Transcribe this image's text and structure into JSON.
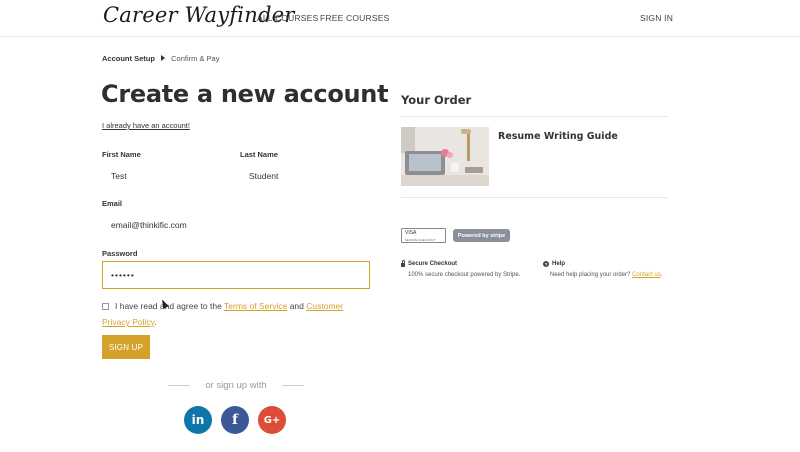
{
  "header": {
    "logo": "Career Wayfinder",
    "nav": [
      "ALL COURSES",
      "FREE COURSES"
    ],
    "signin": "SIGN IN"
  },
  "breadcrumb": {
    "active": "Account Setup",
    "inactive": "Confirm & Pay"
  },
  "page_title": "Create a new account",
  "already_link": "I already have an account!",
  "form": {
    "first_name": {
      "label": "First Name",
      "value": "Test"
    },
    "last_name": {
      "label": "Last Name",
      "value": "Student"
    },
    "email": {
      "label": "Email",
      "value": "email@thinkific.com"
    },
    "password": {
      "label": "Password",
      "value": "••••••"
    },
    "terms": {
      "prefix": "I have read and agree to the",
      "tos": "Terms of Service",
      "and": "and",
      "privacy": "Customer Privacy Policy",
      "suffix": "."
    },
    "signup_button": "SIGN UP",
    "or_text": "or sign up with",
    "social": {
      "linkedin": "in",
      "facebook": "f",
      "google": "G+"
    }
  },
  "order": {
    "title": "Your Order",
    "product_name": "Resume Writing Guide",
    "card_badge": "VISA",
    "card_badge_sub": "SECURE CHECKOUT",
    "stripe_badge": "Powered by stripe",
    "secure_head": "Secure Checkout",
    "secure_text": "100% secure checkout powered by Stripe.",
    "help_head": "Help",
    "help_text": "Need help placing your order?",
    "help_link": "Contact us",
    "help_suffix": "."
  },
  "colors": {
    "accent": "#d4a12a",
    "linkedin": "#0e76a8",
    "facebook": "#3b5998",
    "google": "#dd4b39"
  }
}
